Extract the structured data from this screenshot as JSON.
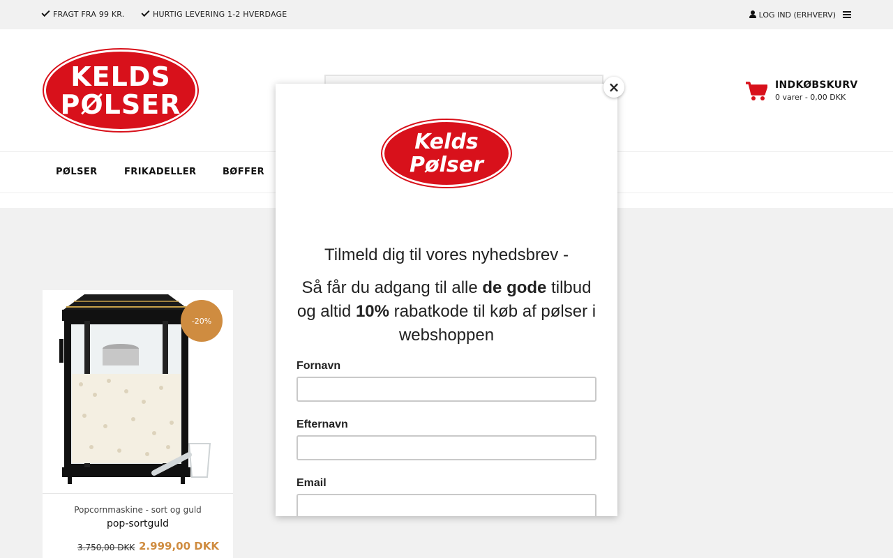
{
  "topbar": {
    "usp1": "FRAGT FRA 99 KR.",
    "usp2": "HURTIG LEVERING 1-2 HVERDAGE",
    "login": "LOG IND (ERHVERV)"
  },
  "header": {
    "logo_line1": "KELDS",
    "logo_line2": "PØLSER",
    "cart_title": "INDKØBSKURV",
    "cart_summary": "0 varer - 0,00 DKK"
  },
  "nav": {
    "items": [
      "PØLSER",
      "FRIKADELLER",
      "BØFFER"
    ]
  },
  "product": {
    "discount": "-20%",
    "name": "Popcornmaskine - sort og guld",
    "sku": "pop-sortguld",
    "price_old": "3.750,00 DKK",
    "price_new": "2.999,00 DKK"
  },
  "popup": {
    "logo_line1": "Kelds",
    "logo_line2": "Pølser",
    "heading": "Tilmeld dig til vores nyhedsbrev -",
    "text_part1": "Så får du adgang til alle ",
    "text_bold1": "de gode",
    "text_part2": " tilbud og altid ",
    "text_bold2": "10%",
    "text_part3": " rabatkode til køb af pølser i webshoppen",
    "label_firstname": "Fornavn",
    "label_lastname": "Efternavn",
    "label_email": "Email",
    "close": "×"
  },
  "colors": {
    "brand_red": "#d8111b",
    "accent_gold": "#cf8c40"
  }
}
